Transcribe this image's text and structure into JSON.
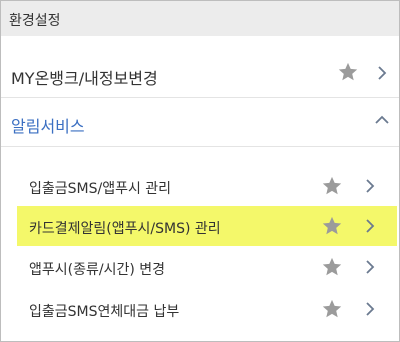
{
  "header": {
    "title": "환경설정"
  },
  "rows": {
    "my_account": {
      "label": "MY온뱅크/내정보변경"
    },
    "alert_service": {
      "label": "알림서비스"
    },
    "sub_items": [
      {
        "label": "입출금SMS/앱푸시 관리"
      },
      {
        "label": "카드결제알림(앱푸시/SMS) 관리"
      },
      {
        "label": "앱푸시(종류/시간) 변경"
      },
      {
        "label": "입출금SMS연체대금 납부"
      }
    ]
  },
  "colors": {
    "header_bg": "#ececec",
    "section_text": "#3b6fc2",
    "highlight": "#f4f86a",
    "star": "#9b9b9b",
    "chevron": "#6b7a90"
  },
  "icons": {
    "favorite": "star-icon",
    "navigate": "chevron-right-icon",
    "collapse": "chevron-up-icon"
  }
}
